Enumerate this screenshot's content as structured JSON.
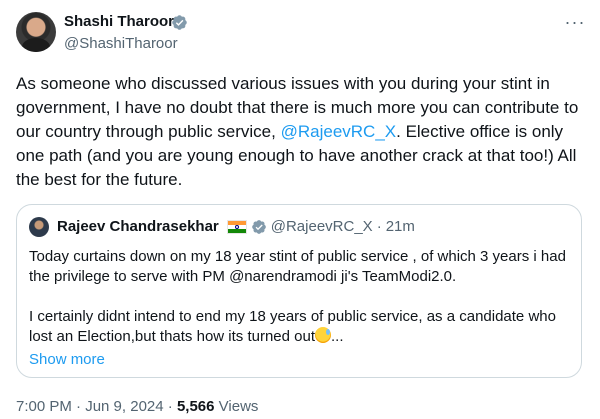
{
  "author": {
    "name": "Shashi Tharoor",
    "handle": "@ShashiTharoor",
    "verified": true
  },
  "more_menu": "···",
  "tweet_text": {
    "before_mention": "As someone who discussed various issues with you during your stint in government, I have no doubt that there is much more you can contribute to our country through public service, ",
    "mention": "@RajeevRC_X",
    "after_mention": ". Elective office is only one path (and you are young enough to have another crack at that too!) All the best for the future."
  },
  "quoted_tweet": {
    "author_name": "Rajeev Chandrasekhar",
    "flag": "india-flag-emoji",
    "verified": true,
    "handle": "@RajeevRC_X",
    "separator": "·",
    "time": "21m",
    "paragraph1": "Today curtains down on my 18 year stint of public service , of which 3 years i had the privilege to serve with PM @narendramodi ji's TeamModi2.0.",
    "paragraph2": "I certainly didnt intend to end my 18 years of public service, as a candidate who lost an Election,but thats how its turned out",
    "paragraph2_suffix": "...",
    "emoji": "sweat-smile-emoji",
    "show_more": "Show more"
  },
  "footer": {
    "timestamp": "7:00 PM · Jun 9, 2024",
    "separator": "·",
    "views_count": "5,566",
    "views_label": "Views"
  },
  "colors": {
    "link": "#1d9bf0",
    "secondary_text": "#536471",
    "primary_text": "#0f1419",
    "border": "#cfd9de"
  }
}
